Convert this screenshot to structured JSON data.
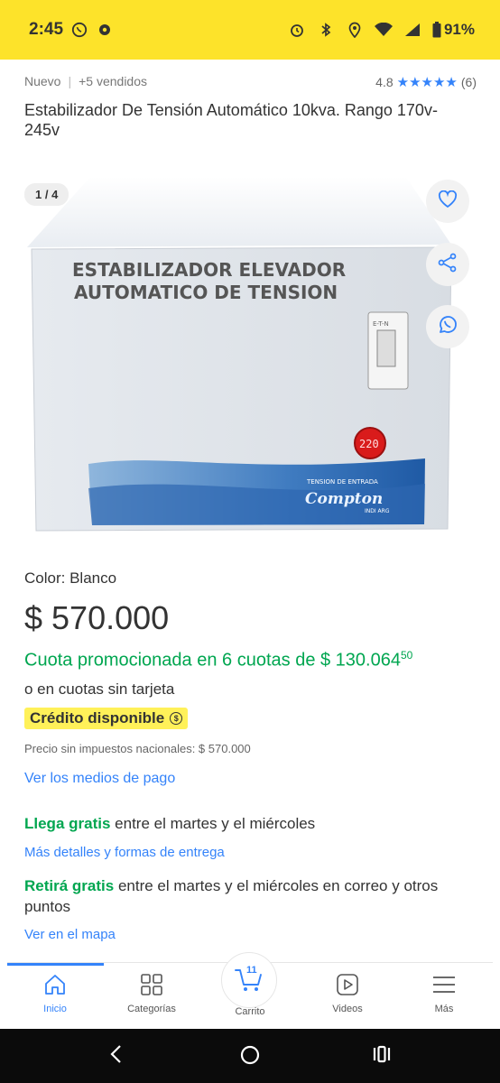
{
  "status": {
    "time": "2:45",
    "battery": "91%",
    "icons": [
      "whatsapp-icon",
      "notification-icon",
      "alarm-icon",
      "bluetooth-icon",
      "location-icon",
      "wifi-icon",
      "signal-icon",
      "battery-icon"
    ]
  },
  "product": {
    "condition": "Nuevo",
    "sold": "+5 vendidos",
    "rating": "4.8",
    "reviews": "(6)",
    "title": "Estabilizador De Tensión Automático 10kva. Rango 170v-245v",
    "image_counter": "1 / 4",
    "image_text_line1": "ESTABILIZADOR ELEVADOR",
    "image_text_line2": "AUTOMATICO DE TENSION",
    "image_display": "220",
    "image_small_text": "TENSION DE ENTRADA",
    "image_brand": "Compton",
    "image_brand_sub": "INDI ARG",
    "breaker_label": "E-T-N",
    "color_label": "Color:",
    "color_value": "Blanco",
    "price": "$ 570.000",
    "installments_text": "Cuota promocionada en 6 cuotas de $ 130.064",
    "installments_cents": "50",
    "no_card": "o en cuotas sin tarjeta",
    "credit_badge": "Crédito disponible",
    "credit_coin": "$",
    "tax_note": "Precio sin impuestos nacionales: $ 570.000",
    "payment_link": "Ver los medios de pago",
    "shipping_strong": "Llega gratis",
    "shipping_rest": "entre el martes y el miércoles",
    "shipping_link": "Más detalles y formas de entrega",
    "pickup_strong": "Retirá gratis",
    "pickup_rest": "entre el martes y el miércoles en correo y otros puntos",
    "map_link": "Ver en el mapa"
  },
  "nav": {
    "inicio": "Inicio",
    "categorias": "Categorías",
    "carrito": "Carrito",
    "cart_count": "11",
    "videos": "Videos",
    "mas": "Más"
  },
  "colors": {
    "status_yellow": "#fde32a",
    "accent_blue": "#3483fa",
    "green": "#00a650",
    "credit_yellow": "#fff159"
  }
}
